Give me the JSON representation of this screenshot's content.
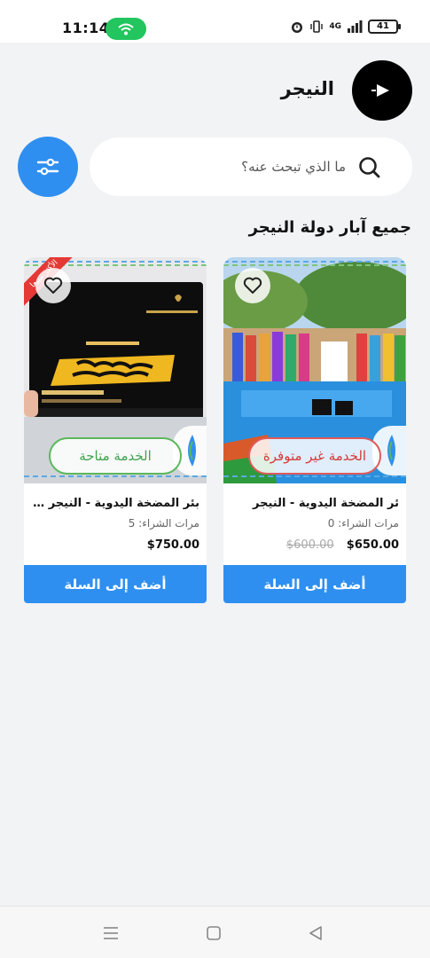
{
  "status_bar": {
    "time": "11:14",
    "network": "4G",
    "battery": "41",
    "icons": [
      "wifi-icon",
      "alarm-icon",
      "vibrate-icon",
      "signal-icon",
      "battery-icon"
    ]
  },
  "header": {
    "title": "النيجر",
    "play_icon": "play-icon"
  },
  "search": {
    "placeholder": "ما الذي تبحث عنه؟",
    "search_icon": "search-icon",
    "filter_icon": "filter-icon"
  },
  "section": {
    "title": "جميع آبار دولة النيجر"
  },
  "colors": {
    "accent": "#2f8ff0",
    "unavailable": "#d63a3a",
    "available": "#3fa34d",
    "background": "#f2f3f5"
  },
  "products": [
    {
      "name": "ئر المضخة اليدوية - النيجر",
      "purchases_label": "مرات الشراء: 0",
      "price": "$650.00",
      "old_price": "$600.00",
      "status": "الخدمة غير متوفرة",
      "add_to_cart": "أضف إلى السلة",
      "image": "well-photo-people"
    },
    {
      "name": "بئر المضخة اليدوية - النيجر مع...",
      "purchases_label": "مرات الشراء: 5",
      "price": "$750.00",
      "old_price": "",
      "status": "الخدمة متاحة",
      "add_to_cart": "أضف إلى السلة",
      "image": "gift-card-photo",
      "ribbon": "الأكثر مبيعا"
    }
  ],
  "nav_bar": [
    "menu-icon",
    "home-icon",
    "back-icon"
  ]
}
